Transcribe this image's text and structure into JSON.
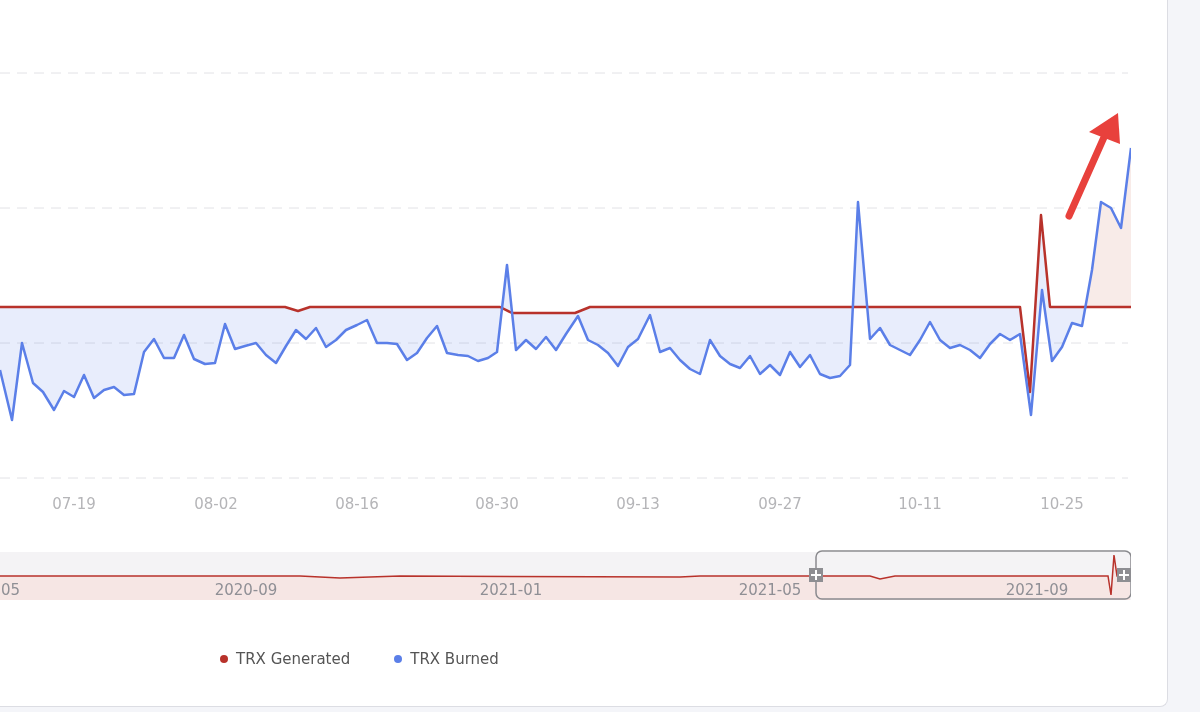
{
  "chart": {
    "x_labels": [
      "07-19",
      "08-02",
      "08-16",
      "08-30",
      "09-13",
      "09-27",
      "10-11",
      "10-25"
    ]
  },
  "overview": {
    "labels": [
      "05",
      "2020-09",
      "2021-01",
      "2021-05",
      "2021-09"
    ]
  },
  "legend": [
    {
      "label": "TRX Generated",
      "color": "#b8322b"
    },
    {
      "label": "TRX Burned",
      "color": "#5b7fe8"
    }
  ]
}
